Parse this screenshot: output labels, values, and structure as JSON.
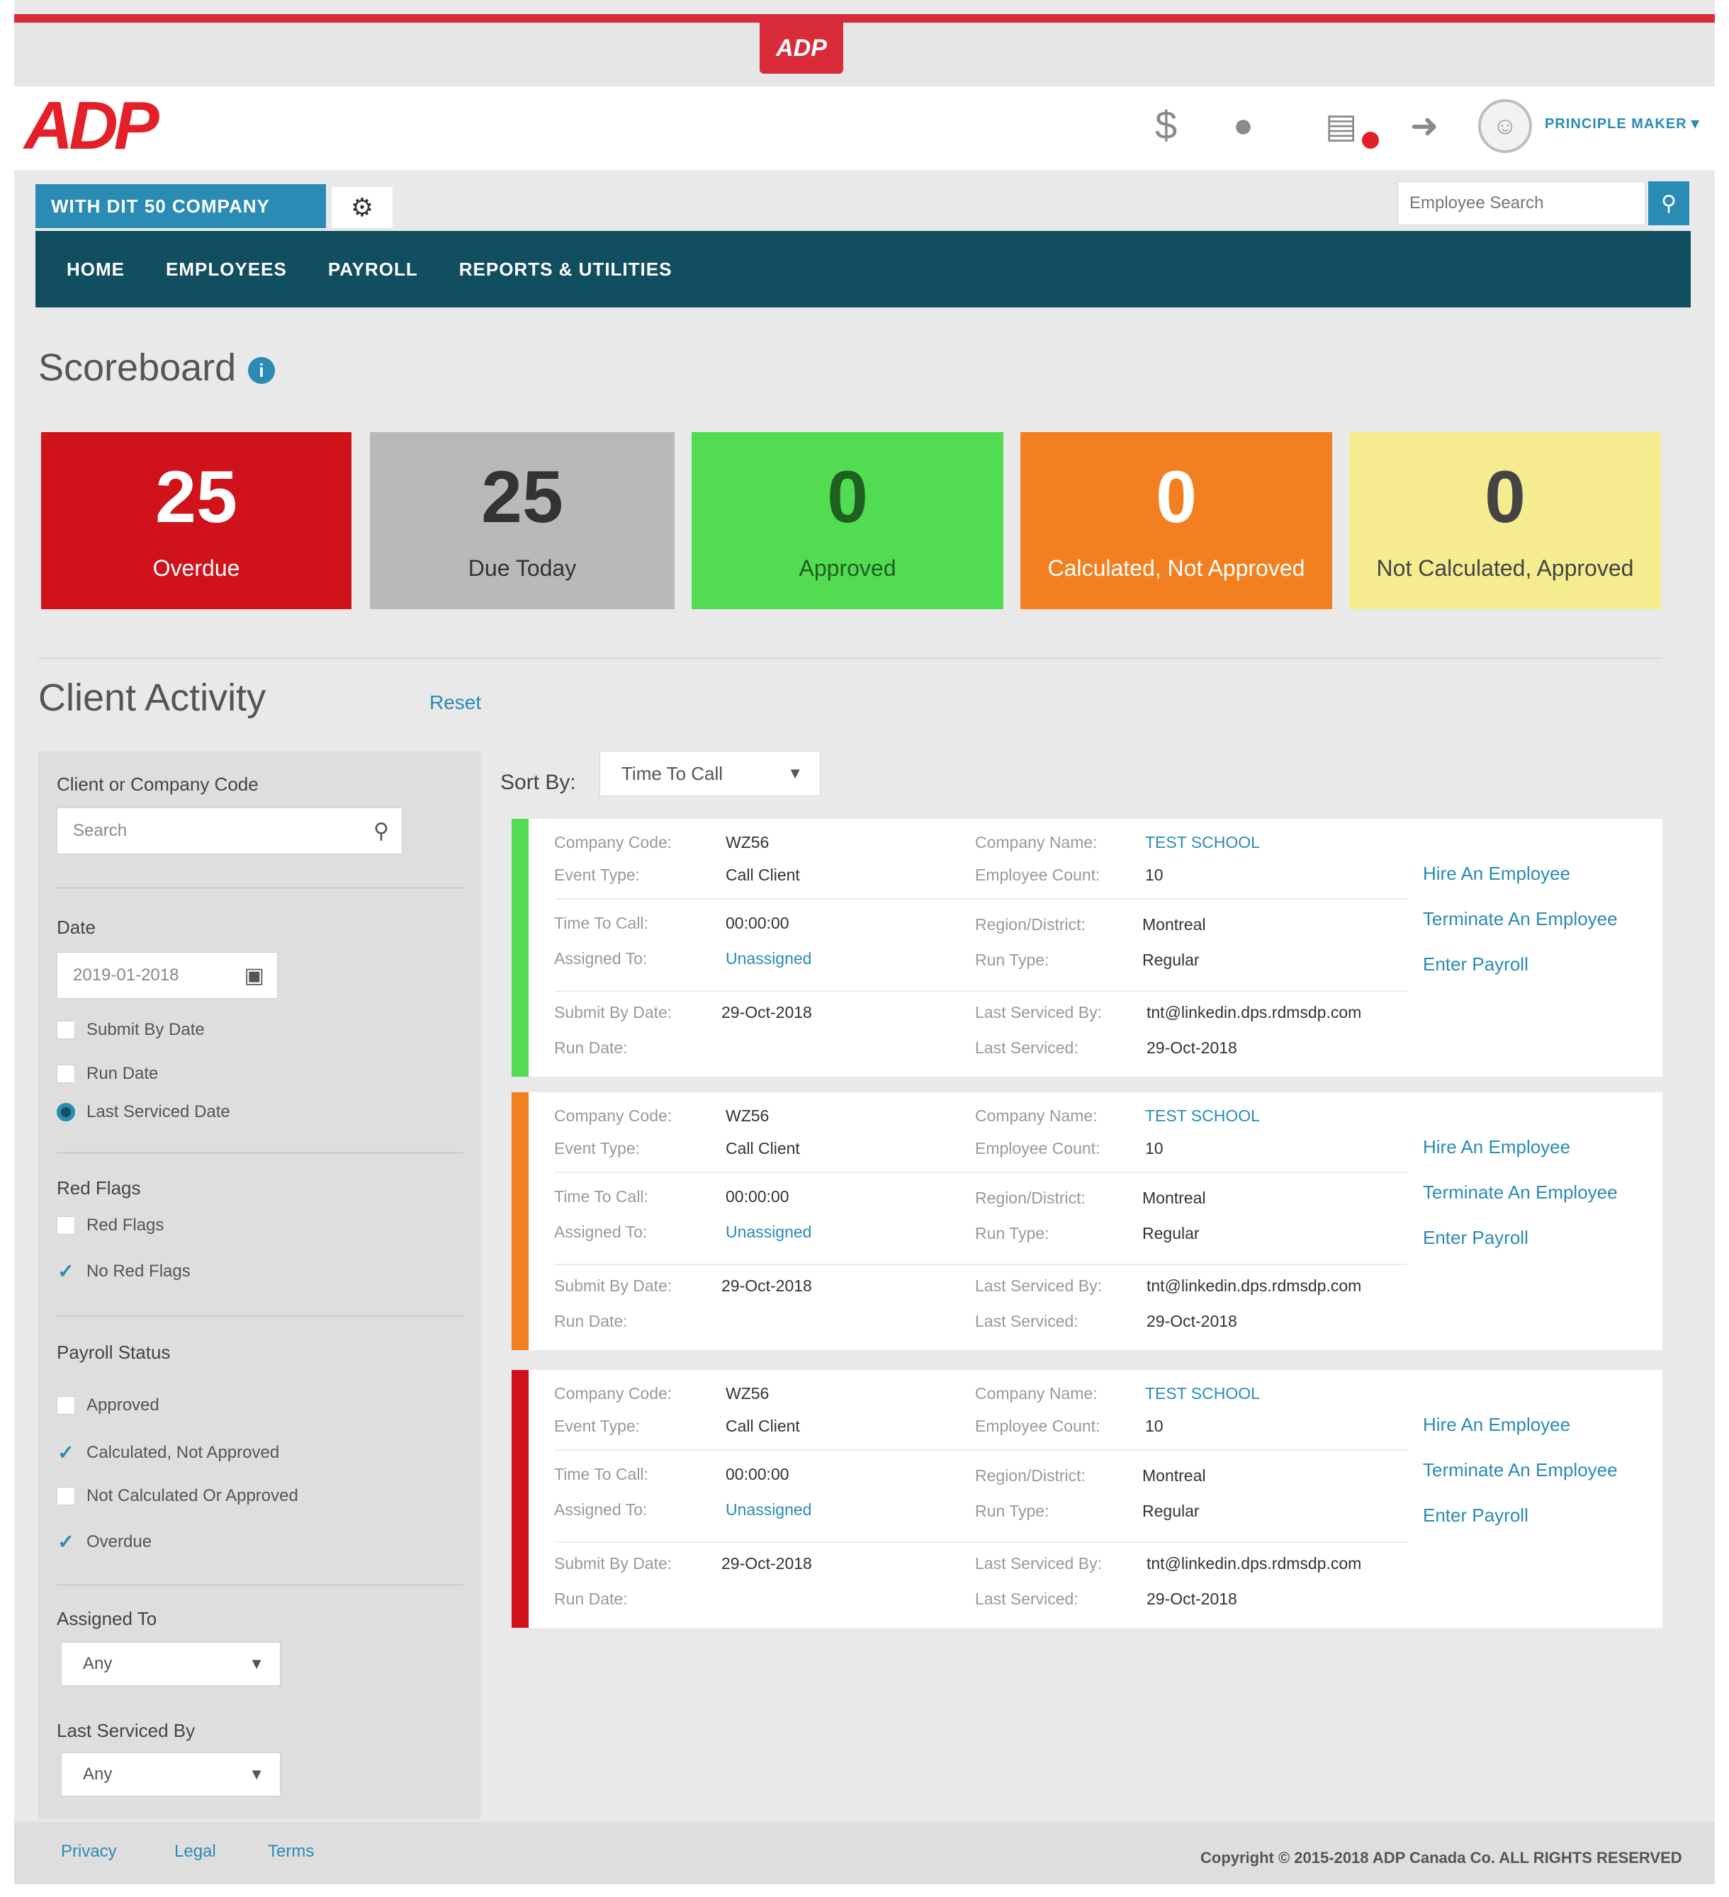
{
  "brand": {
    "top_badge": "ADP",
    "logo": "ADP",
    "brand_color": "#e3202a",
    "accent_color": "#2a8bb5",
    "nav_color": "#114e60"
  },
  "header": {
    "icons": [
      "dollar-icon",
      "chat-icon",
      "inbox-icon",
      "sign-out-icon"
    ],
    "username": "PRINCIPLE MAKER"
  },
  "company": {
    "tab_label": "WITH DIT 50 COMPANY",
    "employee_search_placeholder": "Employee Search"
  },
  "nav": {
    "items": [
      "HOME",
      "EMPLOYEES",
      "PAYROLL",
      "REPORTS & UTILITIES"
    ]
  },
  "scoreboard": {
    "title": "Scoreboard",
    "tiles": [
      {
        "value": "25",
        "label": "Overdue",
        "bg": "#d0121b",
        "fg": "#ffffff"
      },
      {
        "value": "25",
        "label": "Due Today",
        "bg": "#b9b9b9",
        "fg": "#333333"
      },
      {
        "value": "0",
        "label": "Approved",
        "bg": "#52dc52",
        "fg": "#1f5f1f"
      },
      {
        "value": "0",
        "label": "Calculated, Not Approved",
        "bg": "#f28020",
        "fg": "#ffffff"
      },
      {
        "value": "0",
        "label": "Not Calculated, Approved",
        "bg": "#f5ec90",
        "fg": "#444444"
      }
    ]
  },
  "client_activity": {
    "title": "Client Activity",
    "reset_label": "Reset"
  },
  "filters": {
    "client_label": "Client or Company Code",
    "search_placeholder": "Search",
    "date_label": "Date",
    "date_value": "2019-01-2018",
    "date_options": [
      {
        "label": "Submit By Date",
        "selected": false
      },
      {
        "label": "Run Date",
        "selected": false
      },
      {
        "label": "Last Serviced Date",
        "selected": true
      }
    ],
    "red_flags_label": "Red Flags",
    "red_flag_options": [
      {
        "label": "Red Flags",
        "checked": false
      },
      {
        "label": "No Red Flags",
        "checked": true
      }
    ],
    "payroll_status_label": "Payroll Status",
    "payroll_status_options": [
      {
        "label": "Approved",
        "checked": false
      },
      {
        "label": "Calculated, Not Approved",
        "checked": true
      },
      {
        "label": "Not Calculated Or Approved",
        "checked": false
      },
      {
        "label": "Overdue",
        "checked": true
      }
    ],
    "assigned_to_label": "Assigned To",
    "assigned_to_value": "Any",
    "last_serviced_by_label": "Last Serviced By",
    "last_serviced_by_value": "Any"
  },
  "sort": {
    "label": "Sort By:",
    "value": "Time To Call"
  },
  "cards": [
    {
      "status_color": "#52dc52",
      "company_code_label": "Company Code:",
      "company_code": "WZ56",
      "event_type_label": "Event Type:",
      "event_type": "Call Client",
      "company_name_label": "Company Name:",
      "company_name": "TEST SCHOOL",
      "employee_count_label": "Employee Count:",
      "employee_count": "10",
      "time_to_call_label": "Time To Call:",
      "time_to_call": "00:00:00",
      "assigned_to_label": "Assigned To:",
      "assigned_to": "Unassigned",
      "region_label": "Region/District:",
      "region": "Montreal",
      "run_type_label": "Run Type:",
      "run_type": "Regular",
      "submit_by_label": "Submit By Date:",
      "submit_by": "29-Oct-2018",
      "run_date_label": "Run Date:",
      "last_serviced_by_label": "Last Serviced By:",
      "last_serviced_by": "tnt@linkedin.dps.rdmsdp.com",
      "last_serviced_label": "Last Serviced:",
      "last_serviced": "29-Oct-2018",
      "actions": [
        "Hire An Employee",
        "Terminate An Employee",
        "Enter Payroll"
      ]
    },
    {
      "status_color": "#f28020",
      "company_code_label": "Company Code:",
      "company_code": "WZ56",
      "event_type_label": "Event Type:",
      "event_type": "Call Client",
      "company_name_label": "Company Name:",
      "company_name": "TEST SCHOOL",
      "employee_count_label": "Employee Count:",
      "employee_count": "10",
      "time_to_call_label": "Time To Call:",
      "time_to_call": "00:00:00",
      "assigned_to_label": "Assigned To:",
      "assigned_to": "Unassigned",
      "region_label": "Region/District:",
      "region": "Montreal",
      "run_type_label": "Run Type:",
      "run_type": "Regular",
      "submit_by_label": "Submit By Date:",
      "submit_by": "29-Oct-2018",
      "run_date_label": "Run Date:",
      "last_serviced_by_label": "Last Serviced By:",
      "last_serviced_by": "tnt@linkedin.dps.rdmsdp.com",
      "last_serviced_label": "Last Serviced:",
      "last_serviced": "29-Oct-2018",
      "actions": [
        "Hire An Employee",
        "Terminate An Employee",
        "Enter Payroll"
      ]
    },
    {
      "status_color": "#d0121b",
      "company_code_label": "Company Code:",
      "company_code": "WZ56",
      "event_type_label": "Event Type:",
      "event_type": "Call Client",
      "company_name_label": "Company Name:",
      "company_name": "TEST SCHOOL",
      "employee_count_label": "Employee Count:",
      "employee_count": "10",
      "time_to_call_label": "Time To Call:",
      "time_to_call": "00:00:00",
      "assigned_to_label": "Assigned To:",
      "assigned_to": "Unassigned",
      "region_label": "Region/District:",
      "region": "Montreal",
      "run_type_label": "Run Type:",
      "run_type": "Regular",
      "submit_by_label": "Submit By Date:",
      "submit_by": "29-Oct-2018",
      "run_date_label": "Run Date:",
      "last_serviced_by_label": "Last Serviced By:",
      "last_serviced_by": "tnt@linkedin.dps.rdmsdp.com",
      "last_serviced_label": "Last Serviced:",
      "last_serviced": "29-Oct-2018",
      "actions": [
        "Hire An Employee",
        "Terminate An Employee",
        "Enter Payroll"
      ]
    }
  ],
  "footer": {
    "links": [
      "Privacy",
      "Legal",
      "Terms"
    ],
    "copyright": "Copyright © 2015-2018 ADP Canada Co. ALL RIGHTS RESERVED"
  }
}
